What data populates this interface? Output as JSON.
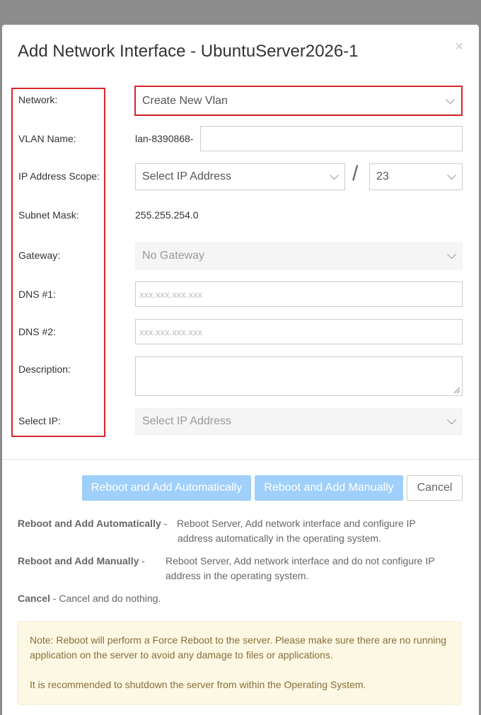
{
  "modal": {
    "title": "Add Network Interface - UbuntuServer2026-1",
    "close": "×"
  },
  "labels": {
    "network": "Network:",
    "vlan_name": "VLAN Name:",
    "ip_scope": "IP Address Scope:",
    "subnet_mask": "Subnet Mask:",
    "gateway": "Gateway:",
    "dns1": "DNS #1:",
    "dns2": "DNS #2:",
    "description": "Description:",
    "select_ip": "Select IP:"
  },
  "fields": {
    "network_value": "Create New Vlan",
    "vlan_prefix": "lan-8390868-",
    "vlan_suffix": "",
    "ip_scope_value": "Select IP Address",
    "cidr_value": "23",
    "subnet_mask_value": "255.255.254.0",
    "gateway_value": "No Gateway",
    "dns1_placeholder": "xxx.xxx.xxx.xxx",
    "dns2_placeholder": "xxx.xxx.xxx.xxx",
    "description_value": "",
    "select_ip_value": "Select IP Address",
    "slash": "/"
  },
  "buttons": {
    "reboot_auto": "Reboot and Add Automatically",
    "reboot_manual": "Reboot and Add Manually",
    "cancel": "Cancel"
  },
  "descriptions": {
    "auto_term": "Reboot and Add Automatically",
    "auto_sep": " - ",
    "auto_line1": "Reboot Server, Add network interface and configure IP",
    "auto_line2": "address automatically in the operating system.",
    "manual_term": "Reboot and Add Manually",
    "manual_sep": " - ",
    "manual_line1": "Reboot Server, Add network interface and do not configure IP",
    "manual_line2": "address in the operating system.",
    "cancel_term": "Cancel",
    "cancel_text": " - Cancel and do nothing."
  },
  "note": {
    "line1": "Note: Reboot will perform a Force Reboot to the server. Please make sure there are no running application on the server to avoid any damage to files or applications.",
    "line2": "It is recommended to shutdown the server from within the Operating System."
  },
  "colors": {
    "highlight": "#d9262c",
    "primary_button": "#9fd0fb",
    "note_bg": "#fcf8e3",
    "note_text": "#8a6d3b"
  }
}
